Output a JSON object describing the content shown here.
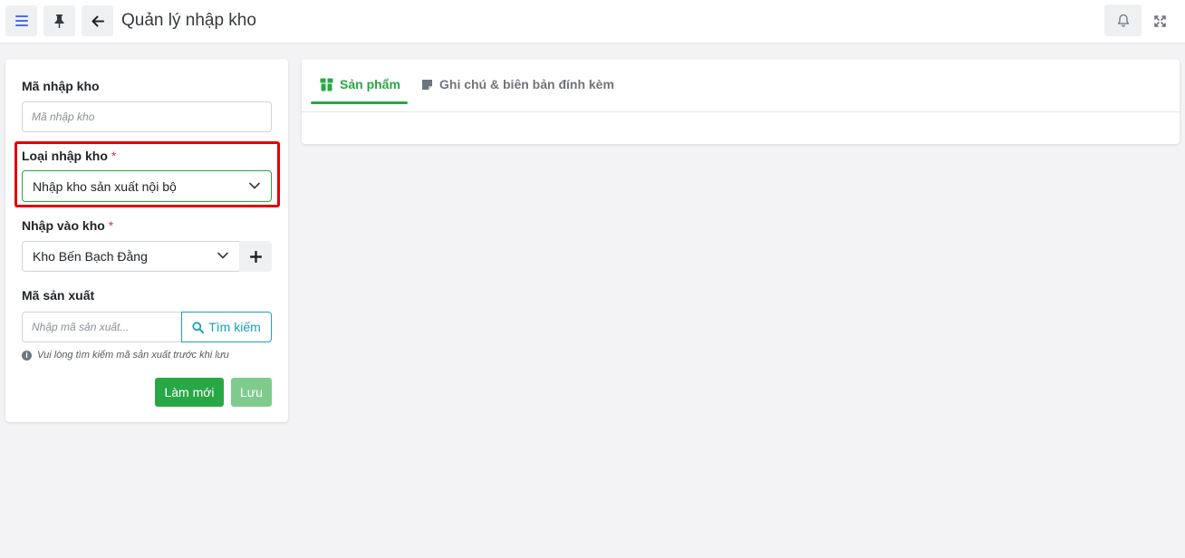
{
  "header": {
    "title": "Quản lý nhập kho",
    "icons": [
      "menu-icon",
      "pin-icon",
      "back-arrow-icon",
      "bell-icon",
      "fullscreen-icon"
    ]
  },
  "form": {
    "receipt_code": {
      "label": "Mã nhập kho",
      "placeholder": "Mã nhập kho"
    },
    "receipt_type": {
      "label": "Loại nhập kho",
      "required_mark": "*",
      "value": "Nhập kho sản xuất nội bộ"
    },
    "warehouse": {
      "label": "Nhập vào kho",
      "required_mark": "*",
      "value": "Kho Bến Bạch Đằng"
    },
    "production_code": {
      "label": "Mã sản xuất",
      "placeholder": "Nhập mã sản xuất...",
      "search_label": "Tìm kiếm"
    },
    "hint": "Vui lòng tìm kiếm mã sản xuất trước khi lưu",
    "refresh_label": "Làm mới",
    "save_label": "Lưu"
  },
  "tabs": [
    {
      "label": "Sản phẩm",
      "active": true
    },
    {
      "label": "Ghi chú & biên bản đính kèm",
      "active": false
    }
  ],
  "colors": {
    "accent_green": "#28a745",
    "save_disabled": "#7fcb8e",
    "highlight_red": "#e00000",
    "menu_blue": "#4a6cf7",
    "info_teal": "#17a2b8"
  }
}
